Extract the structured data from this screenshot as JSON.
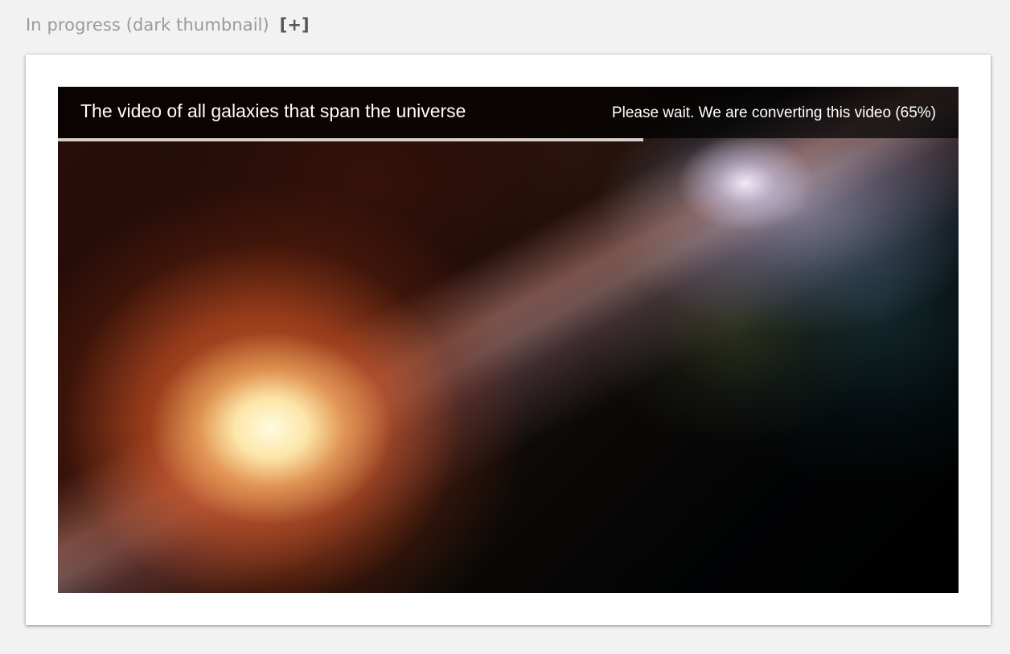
{
  "section": {
    "heading": "In progress (dark thumbnail)",
    "expand_label": "[+]"
  },
  "video": {
    "title": "The video of all galaxies that span the universe",
    "status": "Please wait. We are converting this video (65%)",
    "progress": 0.65,
    "thumbnail": "galaxy-nebula-thumbnail"
  },
  "colors": {
    "page_background": "#f2f2f2",
    "card_background": "#ffffff",
    "heading_text": "#999999",
    "progress_fill": "#d6d0cc",
    "overlay_text": "#ffffff"
  }
}
